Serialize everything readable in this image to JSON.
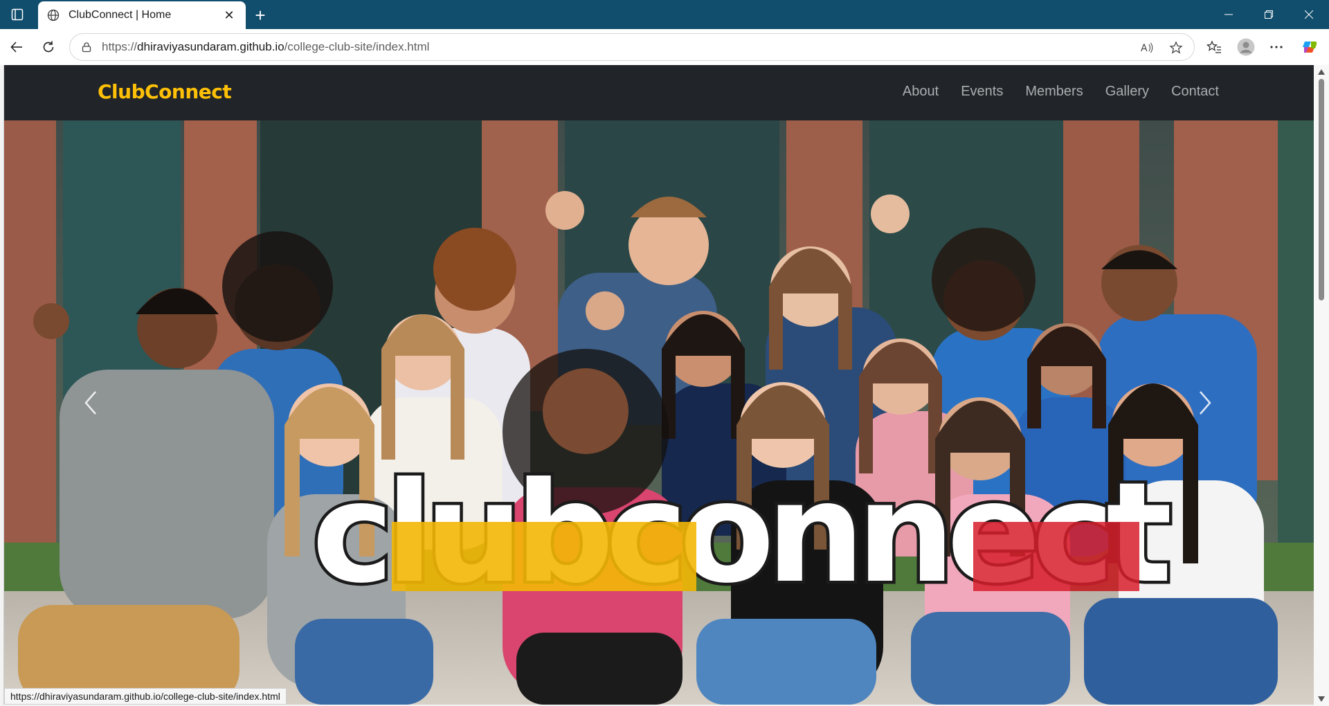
{
  "browser": {
    "tab_title": "ClubConnect | Home",
    "url_scheme": "https://",
    "url_host": "dhiraviyasundaram.github.io",
    "url_path": "/college-club-site/index.html",
    "status_url": "https://dhiraviyasundaram.github.io/college-club-site/index.html"
  },
  "site": {
    "brand": "ClubConnect",
    "brand_color": "#ffc107",
    "nav_bg": "#212529",
    "nav": [
      {
        "label": "About"
      },
      {
        "label": "Events"
      },
      {
        "label": "Members"
      },
      {
        "label": "Gallery"
      },
      {
        "label": "Contact"
      }
    ]
  },
  "hero": {
    "logo_text": "clubconnect",
    "prev_icon": "chevron-left-icon",
    "next_icon": "chevron-right-icon"
  },
  "colors": {
    "chrome": "#114e6d",
    "logo_yellow": "#f2b705",
    "logo_red": "#d71e2b"
  }
}
